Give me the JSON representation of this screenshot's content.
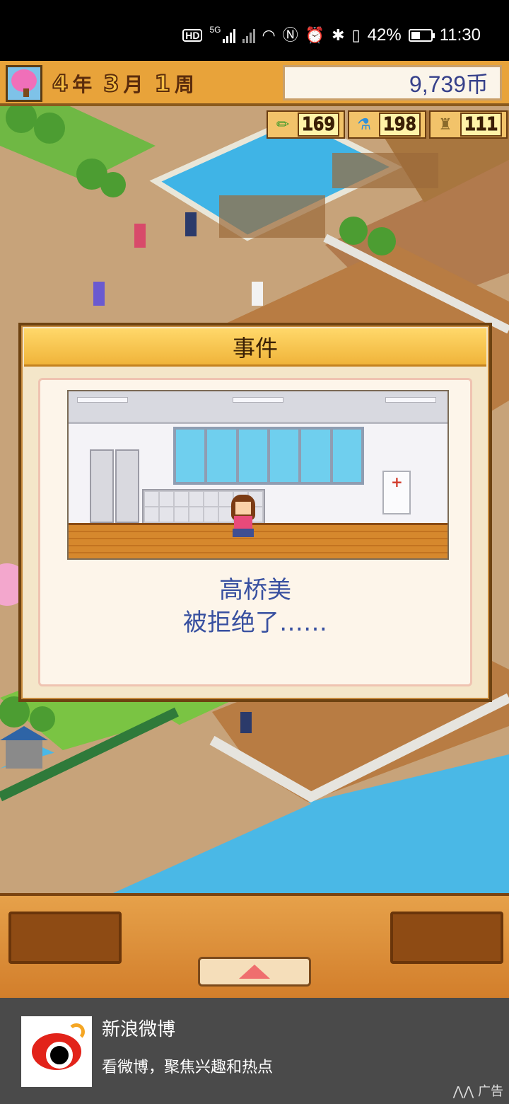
{
  "status_bar": {
    "network": "5G",
    "battery": "42%",
    "time": "11:30"
  },
  "hud": {
    "year": "4",
    "year_unit": "年",
    "month": "3",
    "month_unit": "月",
    "week": "1",
    "week_unit": "周",
    "money": "9,739币",
    "resources": [
      {
        "icon": "pencil-icon",
        "value": "169"
      },
      {
        "icon": "flask-icon",
        "value": "198"
      },
      {
        "icon": "trophy-icon",
        "value": "111"
      }
    ]
  },
  "event": {
    "title": "事件",
    "message_line1": "高桥美",
    "message_line2": "被拒绝了……"
  },
  "ad": {
    "title": "新浪微博",
    "subtitle": "看微博，聚焦兴趣和热点",
    "tag": "广告"
  }
}
